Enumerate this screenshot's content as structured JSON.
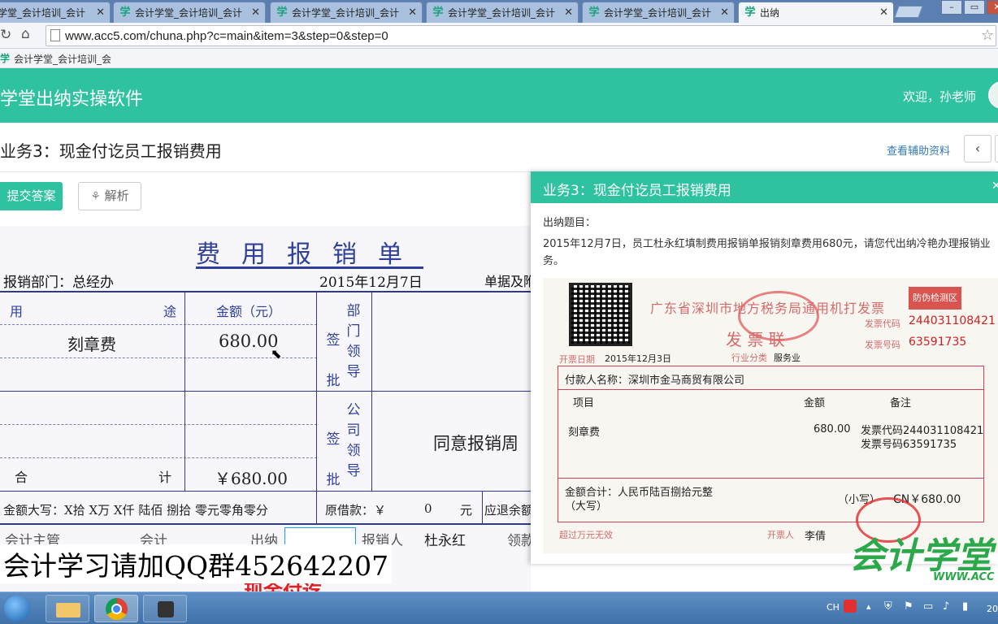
{
  "browser": {
    "tabs": [
      {
        "label": "学堂_会计培训_会计",
        "active": false
      },
      {
        "label": "会计学堂_会计培训_会计",
        "active": false
      },
      {
        "label": "会计学堂_会计培训_会计",
        "active": false
      },
      {
        "label": "会计学堂_会计培训_会计",
        "active": false
      },
      {
        "label": "会计学堂_会计培训_会计",
        "active": false
      },
      {
        "label": "出纳",
        "active": true
      }
    ],
    "tab_icon": "学",
    "url": "www.acc5.com/chuna.php?c=main&item=3&step=0&step=0",
    "bookmark": "会计学堂_会计培训_会",
    "colors": {
      "brand": "#2ec2a0",
      "link": "#337ab7"
    }
  },
  "app": {
    "title": "学堂出纳实操软件",
    "welcome": "欢迎，孙老师",
    "task_title": "业务3：现金付讫员工报销费用",
    "aux_link": "查看辅助资料",
    "prev_icon": "‹",
    "submit_label": "提交答案",
    "analysis_label": "解析"
  },
  "form": {
    "title": "费用报销单",
    "dept_label": "报销部门：总经办",
    "date": "2015年12月7日",
    "doc_label": "单据及附",
    "col_purpose_left": "用",
    "col_purpose_right": "途",
    "col_amount": "金额（元）",
    "row1_purpose": "刻章费",
    "row1_amount": "680.00",
    "dept_sign": [
      "签",
      "批"
    ],
    "dept_lead": [
      "部",
      "门",
      "领",
      "导"
    ],
    "comp_sign": [
      "签",
      "批"
    ],
    "comp_lead": [
      "公",
      "司",
      "领",
      "导"
    ],
    "approval": "同意报销周",
    "total_left": "合",
    "total_right": "计",
    "total_amount": "￥680.00",
    "capital": "金额大写：X拾 X万 X仟 陆佰 捌拾 零元零角零分",
    "loan_label": "原借款：￥",
    "loan_value": "0",
    "loan_unit": "元",
    "refund_label": "应退余额",
    "accounting_supervisor": "会计主管",
    "accountant": "会计",
    "cashier": "出纳",
    "applicant_label": "报销人",
    "applicant": "杜永红",
    "receiver": "领款"
  },
  "overlay": {
    "watermark": "会计学习请加QQ群452642207",
    "red_stamp": "现金付讫"
  },
  "panel": {
    "title": "业务3：现金付讫员工报销费用",
    "question_label": "出纳题目：",
    "description": "2015年12月7日，员工杜永红填制费用报销单报销刻章费用680元，请您代出纳冷艳办理报销业务。",
    "invoice": {
      "header": "广东省深圳市地方税务局通用机打发票",
      "sub": "发 票 联",
      "anti_fake": "防伪检测区",
      "code_label": "发票代码",
      "code": "244031108421",
      "num_label": "发票号码",
      "num": "63591735",
      "date_label": "开票日期",
      "date": "2015年12月3日",
      "industry_label": "行业分类",
      "industry": "服务业",
      "payer": "付款人名称：深圳市金马商贸有限公司",
      "col_item": "项目",
      "col_amount": "金额",
      "col_note": "备注",
      "item": "刻章费",
      "amount": "680.00",
      "note1": "发票代码244031108421",
      "note2": "发票号码63591735",
      "total_label": "金额合计：人民币陆百捌拾元整",
      "total_cap": "（大写）",
      "total_small": "（小写）",
      "total_value": "CN￥680.00",
      "limit": "超过万元无效",
      "issuer_label": "开票人",
      "issuer": "李倩",
      "brand": "会计学堂",
      "brand_url": "WWW.ACC"
    }
  },
  "taskbar": {
    "lang": "CH",
    "clock": "20"
  }
}
